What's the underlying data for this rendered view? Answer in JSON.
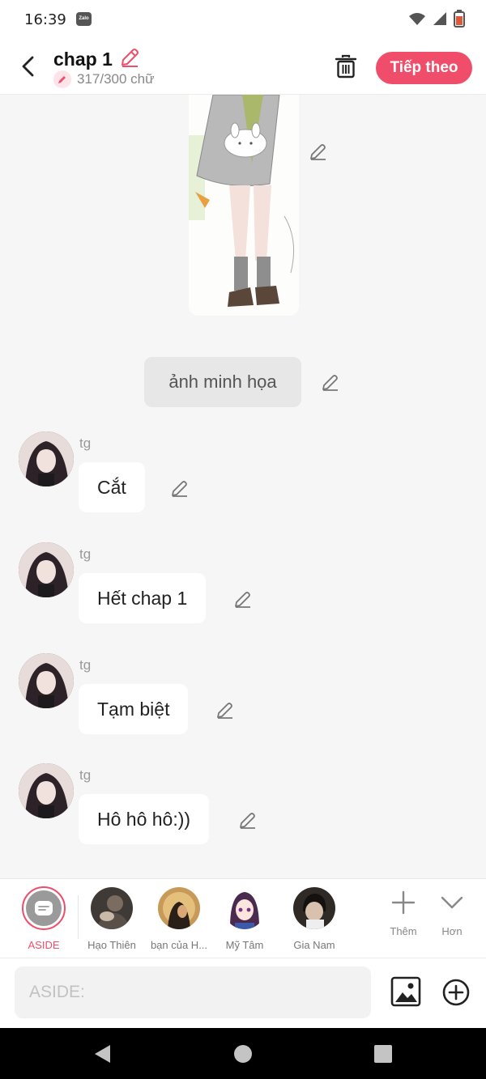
{
  "status_bar": {
    "time": "16:39",
    "zalo_badge": "Zalo"
  },
  "header": {
    "title": "chap 1",
    "word_count": "317/300 chữ",
    "next_button": "Tiếp theo"
  },
  "chat": {
    "caption": "ảnh minh họa",
    "messages": [
      {
        "sender": "tg",
        "text": "Cắt"
      },
      {
        "sender": "tg",
        "text": "Hết chap 1"
      },
      {
        "sender": "tg",
        "text": "Tạm biệt"
      },
      {
        "sender": "tg",
        "text": "Hô hô hô:))"
      }
    ]
  },
  "characters": [
    {
      "name": "ASIDE",
      "selected": true
    },
    {
      "name": "Hạo Thiên"
    },
    {
      "name": "bạn của H..."
    },
    {
      "name": "Mỹ Tâm"
    },
    {
      "name": "Gia Nam"
    }
  ],
  "tools": {
    "add_label": "Thêm",
    "more_label": "Hơn"
  },
  "input": {
    "placeholder": "ASIDE:"
  },
  "colors": {
    "accent": "#f04d6a",
    "background": "#f6f6f6"
  }
}
